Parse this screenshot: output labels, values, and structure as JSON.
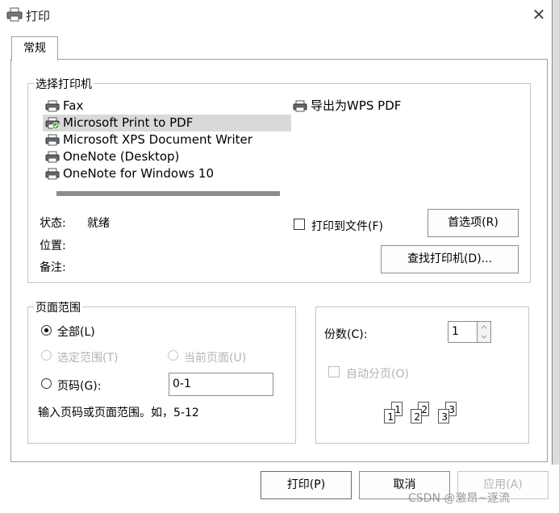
{
  "window": {
    "title": "打印",
    "close_glyph": "✕"
  },
  "tabs": [
    {
      "label": "常规"
    }
  ],
  "printer_group": {
    "label": "选择打印机",
    "printers": [
      {
        "name": "Fax",
        "selected": false,
        "default": false
      },
      {
        "name": "Microsoft Print to PDF",
        "selected": true,
        "default": true
      },
      {
        "name": "Microsoft XPS Document Writer",
        "selected": false,
        "default": false
      },
      {
        "name": "OneNote (Desktop)",
        "selected": false,
        "default": false
      },
      {
        "name": "OneNote for Windows 10",
        "selected": false,
        "default": false
      },
      {
        "name": "导出为WPS PDF",
        "selected": false,
        "default": false
      }
    ],
    "status_label": "状态:",
    "status_value": "就绪",
    "location_label": "位置:",
    "location_value": "",
    "comment_label": "备注:",
    "comment_value": "",
    "print_to_file_label": "打印到文件(F)",
    "print_to_file_checked": false,
    "preferences_button": "首选项(R)",
    "find_printer_button": "查找打印机(D)..."
  },
  "page_range": {
    "label": "页面范围",
    "all_label": "全部(L)",
    "selection_label": "选定范围(T)",
    "current_page_label": "当前页面(U)",
    "pages_label": "页码(G):",
    "pages_value": "0-1",
    "hint": "输入页码或页面范围。如，5-12",
    "selected_option": "all"
  },
  "copies": {
    "label": "份数(C):",
    "value": "1",
    "collate_label": "自动分页(O)",
    "collate_checked": false,
    "collate_icon_numbers": [
      "1",
      "1",
      "2",
      "2",
      "3",
      "3"
    ]
  },
  "footer": {
    "print_button": "打印(P)",
    "cancel_button": "取消",
    "apply_button": "应用(A)"
  },
  "watermark": "CSDN @激昂~逐流",
  "colors": {
    "selected_row": "#d9d9d9",
    "default_check": "#3aa53a",
    "disabled_text": "#b4b4b4"
  }
}
